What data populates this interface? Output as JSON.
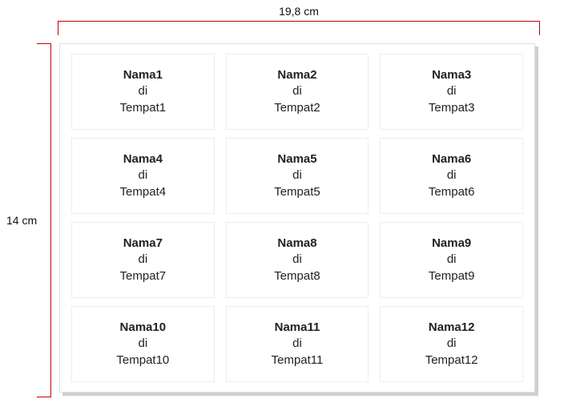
{
  "dimensions": {
    "width_label": "19,8 cm",
    "height_label": "14 cm"
  },
  "label_word": "di",
  "cells": [
    {
      "name": "Nama1",
      "place": "Tempat1"
    },
    {
      "name": "Nama2",
      "place": "Tempat2"
    },
    {
      "name": "Nama3",
      "place": "Tempat3"
    },
    {
      "name": "Nama4",
      "place": "Tempat4"
    },
    {
      "name": "Nama5",
      "place": "Tempat5"
    },
    {
      "name": "Nama6",
      "place": "Tempat6"
    },
    {
      "name": "Nama7",
      "place": "Tempat7"
    },
    {
      "name": "Nama8",
      "place": "Tempat8"
    },
    {
      "name": "Nama9",
      "place": "Tempat9"
    },
    {
      "name": "Nama10",
      "place": "Tempat10"
    },
    {
      "name": "Nama11",
      "place": "Tempat11"
    },
    {
      "name": "Nama12",
      "place": "Tempat12"
    }
  ]
}
